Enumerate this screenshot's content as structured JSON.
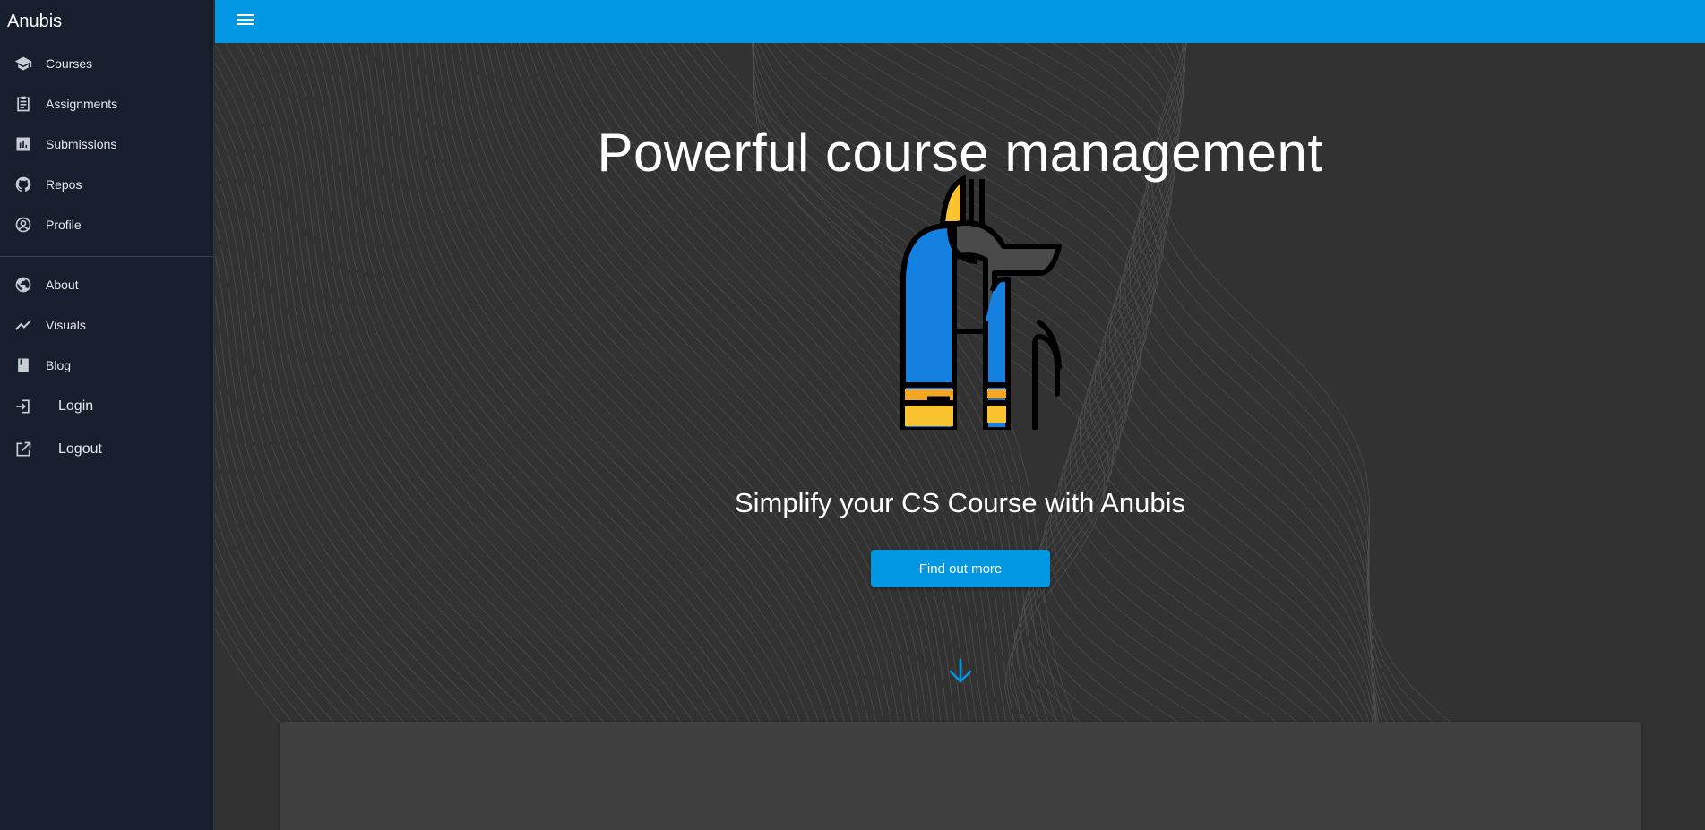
{
  "app": {
    "title": "Anubis"
  },
  "sidebar": {
    "items": [
      {
        "label": "Courses",
        "icon": "school-icon"
      },
      {
        "label": "Assignments",
        "icon": "assignment-icon"
      },
      {
        "label": "Submissions",
        "icon": "bar-chart-icon"
      },
      {
        "label": "Repos",
        "icon": "github-icon"
      },
      {
        "label": "Profile",
        "icon": "account-circle-icon"
      }
    ],
    "secondary_items": [
      {
        "label": "About",
        "icon": "globe-icon"
      },
      {
        "label": "Visuals",
        "icon": "trending-line-icon"
      },
      {
        "label": "Blog",
        "icon": "book-icon"
      },
      {
        "label": "Login",
        "icon": "login-icon"
      },
      {
        "label": "Logout",
        "icon": "open-external-icon"
      }
    ]
  },
  "appbar": {
    "menu_icon": "hamburger-menu-icon",
    "color": "#0197e2"
  },
  "hero": {
    "title": "Powerful course management",
    "subtitle": "Simplify your CS Course with Anubis",
    "cta_label": "Find out more",
    "logo": "anubis-logo",
    "scroll_icon": "arrow-down-icon"
  },
  "colors": {
    "sidebar_bg": "#171f2f",
    "accent": "#0197e2",
    "main_bg": "#323232",
    "card_bg": "#404040"
  }
}
